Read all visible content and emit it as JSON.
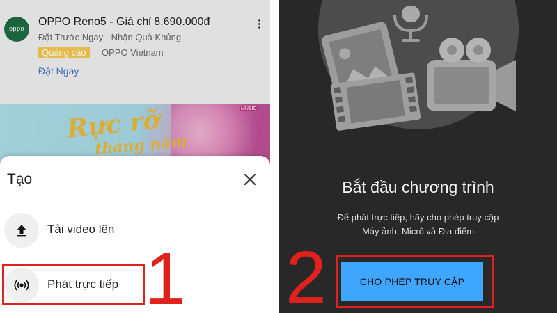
{
  "ad": {
    "logo_text": "oppo",
    "title": "OPPO Reno5 - Giá chỉ 8.690.000đ",
    "subtitle": "Đặt Trước Ngay - Nhận Quà Khủng",
    "badge": "Quảng cáo",
    "brand": "OPPO Vietnam",
    "cta": "Đặt Ngay",
    "more_icon": "more-vert-icon"
  },
  "banner": {
    "line1": "Rực rỡ",
    "line2": "tháng năm",
    "tag": "MUSIC"
  },
  "create_sheet": {
    "title": "Tạo",
    "close_icon": "close-icon",
    "items": [
      {
        "label": "Tải video lên",
        "icon": "upload-icon"
      },
      {
        "label": "Phát trực tiếp",
        "icon": "live-broadcast-icon"
      }
    ]
  },
  "permission": {
    "title": "Bắt đầu chương trình",
    "description_line1": "Để phát trực tiếp, hãy cho phép truy cập",
    "description_line2": "Máy ảnh, Micrô và Địa điểm",
    "button_label": "CHO PHÉP TRUY CẬP"
  },
  "annotations": {
    "step1": "1",
    "step2": "2",
    "highlight_color": "#e1211d"
  },
  "colors": {
    "accent_blue": "#3ea6ff",
    "dark_bg": "#282828",
    "ad_badge": "#f4c84f"
  }
}
